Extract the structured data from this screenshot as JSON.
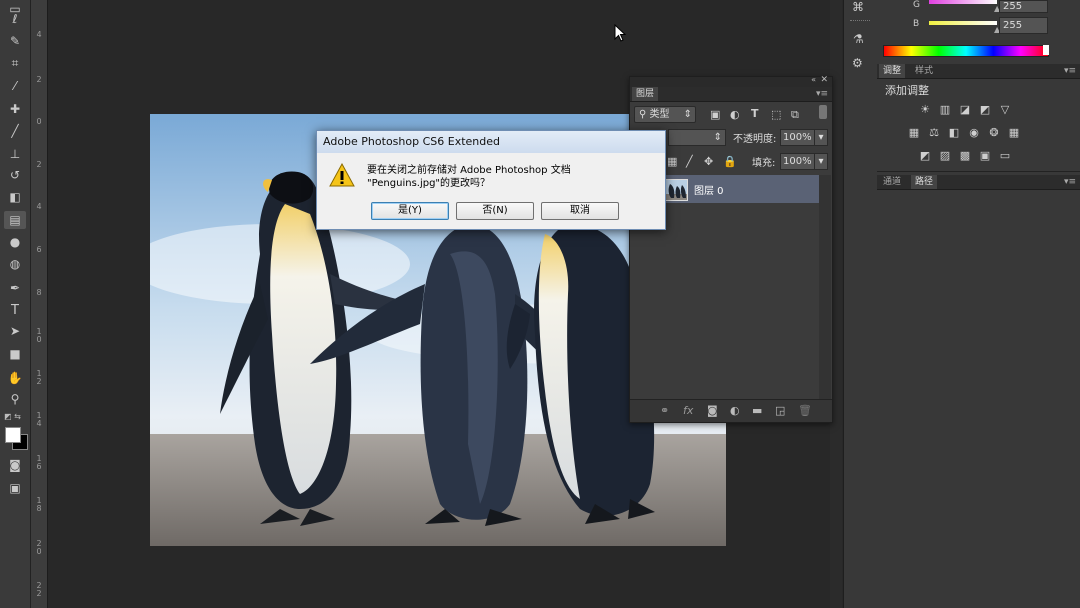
{
  "dialog": {
    "title": "Adobe Photoshop CS6 Extended",
    "message_line1": "要在关闭之前存储对 Adobe Photoshop 文档",
    "message_line2": "\"Penguins.jpg\"的更改吗？",
    "yes_label": "是(Y)",
    "no_label": "否(N)",
    "cancel_label": "取消"
  },
  "ruler_ticks": [
    "4",
    "2",
    "0",
    "2",
    "4",
    "6",
    "8",
    "1 0",
    "1 2",
    "1 4",
    "1 6",
    "1 8",
    "2 0",
    "2 2"
  ],
  "color_panel": {
    "g_label": "G",
    "g_value": "255",
    "b_label": "B",
    "b_value": "255",
    "g_color": "#e040e0",
    "b_color": "#f0f040"
  },
  "adjustments_panel": {
    "tab_adjust": "调整",
    "tab_styles": "样式",
    "heading": "添加调整"
  },
  "paths_panel": {
    "tab_channels": "通道",
    "tab_paths": "路径"
  },
  "layers_panel": {
    "tab": "图层",
    "filter_label": "类型",
    "opacity_label": "不透明度:",
    "opacity_value": "100%",
    "fill_label": "填充:",
    "fill_value": "100%",
    "layer_name": "图层 0"
  },
  "toolbar_icons": [
    "marquee-icon",
    "lasso-icon",
    "quick-select-icon",
    "crop-icon",
    "eyedropper-icon",
    "healing-brush-icon",
    "brush-icon",
    "clone-stamp-icon",
    "history-brush-icon",
    "eraser-icon",
    "gradient-icon",
    "blur-icon",
    "dodge-icon",
    "pen-icon",
    "type-icon",
    "path-select-icon",
    "shape-icon",
    "hand-icon",
    "zoom-icon"
  ],
  "document": {
    "filename": "Penguins.jpg"
  }
}
